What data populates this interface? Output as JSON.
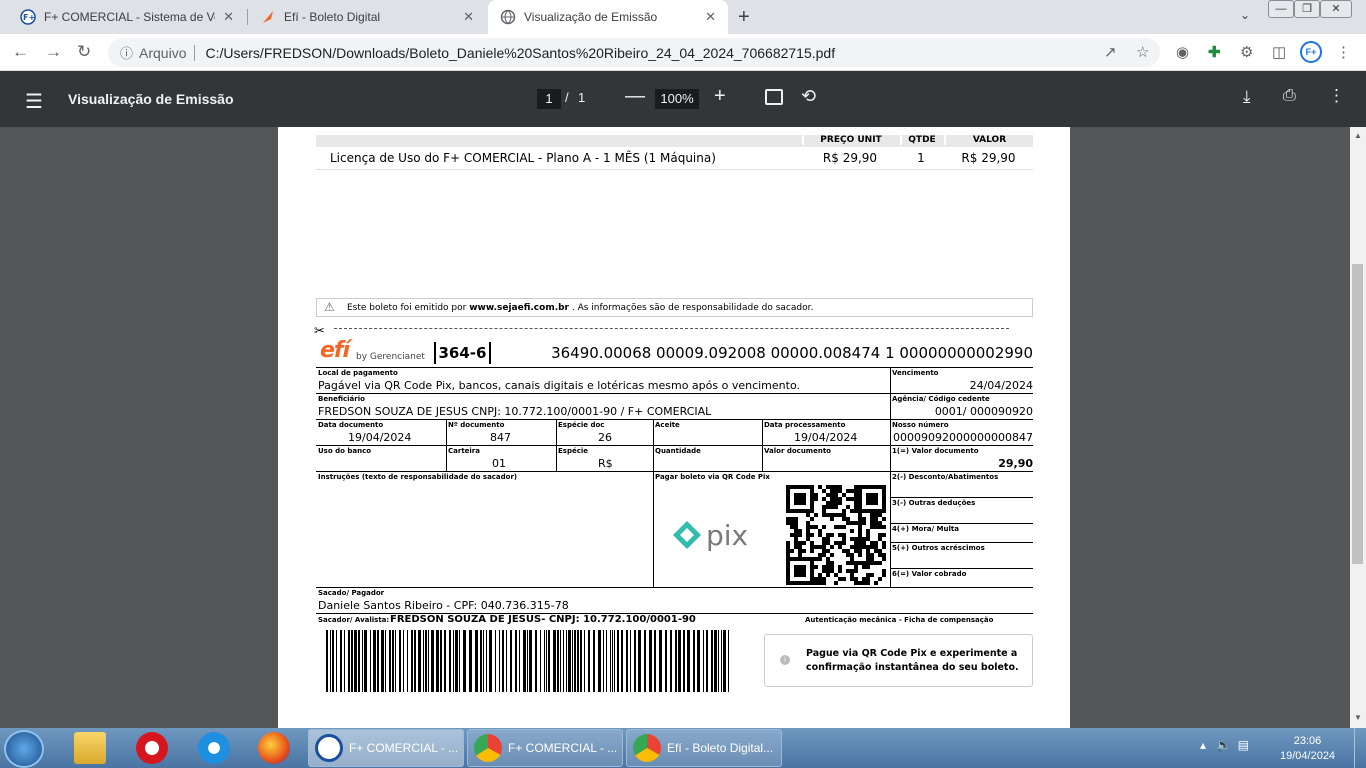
{
  "tabs": [
    {
      "title": "F+ COMERCIAL - Sistema de Vendas",
      "close": "✕"
    },
    {
      "title": "Efí - Boleto Digital",
      "close": "✕"
    },
    {
      "title": "Visualização de Emissão",
      "close": "✕"
    }
  ],
  "new_tab": "+",
  "address": {
    "source": "Arquivo",
    "url": "C:/Users/FREDSON/Downloads/Boleto_Daniele%20Santos%20Ribeiro_24_04_2024_706682715.pdf"
  },
  "profile": "F+",
  "pdf_toolbar": {
    "title": "Visualização de Emissão",
    "page_current": "1",
    "page_sep": "/",
    "page_total": "1",
    "zoom": "100%"
  },
  "items": {
    "headers": {
      "price": "PREÇO UNIT",
      "qty": "QTDE",
      "value": "VALOR"
    },
    "rows": [
      {
        "desc": "Licença de Uso do F+ COMERCIAL - Plano A - 1 MÊS (1 Máquina)",
        "price": "R$ 29,90",
        "qty": "1",
        "value": "R$ 29,90"
      }
    ]
  },
  "notice": {
    "prefix": "Este boleto foi emitido por",
    "site": "www.sejaefi.com.br",
    "suffix": ". As informações são de responsabilidade do sacador."
  },
  "boleto": {
    "logo": "efí",
    "logo_sub": "by Gerencianet",
    "bank_code": "364-6",
    "digitable_line": "36490.00068 00009.092008 00000.008474 1 00000000002990",
    "local_label": "Local de pagamento",
    "local_value": "Pagável via QR Code Pix, bancos, canais digitais e lotéricas mesmo após o vencimento.",
    "venc_label": "Vencimento",
    "venc_value": "24/04/2024",
    "benef_label": "Beneficiário",
    "benef_value": "FREDSON SOUZA DE JESUS CNPJ: 10.772.100/0001-90 / F+ COMERCIAL",
    "agencia_label": "Agência/ Código cedente",
    "agencia_value": "0001/ 000090920",
    "data_doc_label": "Data documento",
    "data_doc_value": "19/04/2024",
    "num_doc_label": "Nº documento",
    "num_doc_value": "847",
    "especie_doc_label": "Espécie doc",
    "especie_doc_value": "26",
    "aceite_label": "Aceite",
    "data_proc_label": "Data processamento",
    "data_proc_value": "19/04/2024",
    "nosso_label": "Nosso número",
    "nosso_value": "00009092000000000847",
    "uso_label": "Uso do banco",
    "carteira_label": "Carteira",
    "carteira_value": "01",
    "especie_label": "Espécie",
    "especie_value": "R$",
    "qtd_label": "Quantidade",
    "valor_label": "Valor documento",
    "valor_doc_label": "1(=) Valor documento",
    "valor_doc_value": "29,90",
    "instr_label": "Instruções (texto de responsabilidade do sacador)",
    "pix_label": "Pagar boleto via QR Code Pix",
    "pix_text": "pix",
    "desc_label": "2(-) Desconto/Abatimentos",
    "outras_label": "3(-) Outras deduções",
    "mora_label": "4(+) Mora/ Multa",
    "acresc_label": "5(+) Outros acréscimos",
    "cobrado_label": "6(=) Valor cobrado",
    "sacado_label": "Sacado/ Pagador",
    "sacado_value": "Daniele Santos Ribeiro - CPF: 040.736.315-78",
    "avalista_label": "Sacador/ Avalista:",
    "avalista_value": "FREDSON SOUZA DE JESUS- CNPJ: 10.772.100/0001-90",
    "auth_label": "Autenticação mecânica - Ficha de compensação",
    "pix_msg_1": "Pague via QR Code Pix e experimente a",
    "pix_msg_2": "confirmação instantânea do seu boleto."
  },
  "taskbar": {
    "tasks": [
      {
        "title": "F+ COMERCIAL - ..."
      },
      {
        "title": "F+ COMERCIAL - ..."
      },
      {
        "title": "Efí - Boleto Digital..."
      }
    ],
    "time": "23:06",
    "date": "19/04/2024"
  }
}
